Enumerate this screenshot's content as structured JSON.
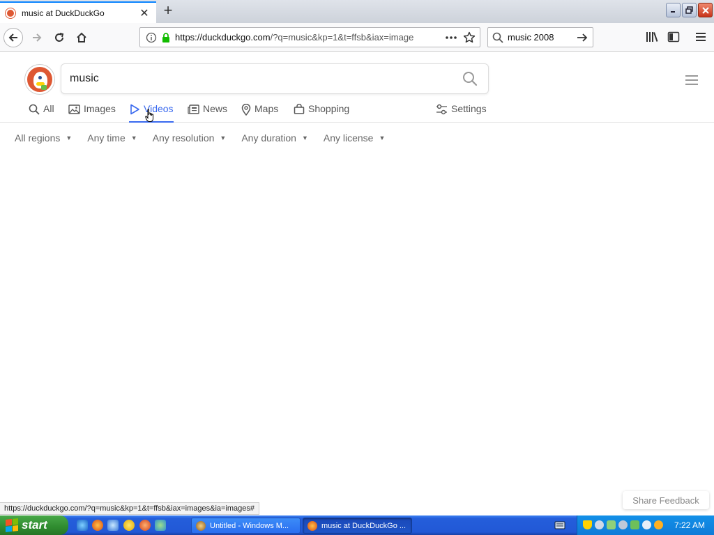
{
  "browser": {
    "tab_title": "music at DuckDuckGo",
    "tab_close": "✕",
    "new_tab": "+",
    "url_host": "https://duckduckgo.com",
    "url_path": "/?q=music&kp=1&t=ffsb&iax=image",
    "search_value": "music 2008",
    "status_url": "https://duckduckgo.com/?q=music&kp=1&t=ffsb&iax=images&ia=images#"
  },
  "search": {
    "query": "music"
  },
  "nav_tabs": [
    {
      "label": "All",
      "icon": "search-icon"
    },
    {
      "label": "Images",
      "icon": "image-icon"
    },
    {
      "label": "Videos",
      "icon": "play-icon",
      "active": true
    },
    {
      "label": "News",
      "icon": "newspaper-icon"
    },
    {
      "label": "Maps",
      "icon": "map-pin-icon"
    },
    {
      "label": "Shopping",
      "icon": "shopping-bag-icon"
    }
  ],
  "settings_label": "Settings",
  "filters": [
    "All regions",
    "Any time",
    "Any resolution",
    "Any duration",
    "Any license"
  ],
  "share_feedback": "Share Feedback",
  "taskbar": {
    "start_label": "start",
    "tasks": [
      "Untitled - Windows M...",
      "music at DuckDuckGo ..."
    ],
    "clock": "7:22 AM"
  },
  "colors": {
    "accent": "#3969ef",
    "ddg_orange": "#de5833",
    "firefox_tab_accent": "#0a84ff"
  }
}
